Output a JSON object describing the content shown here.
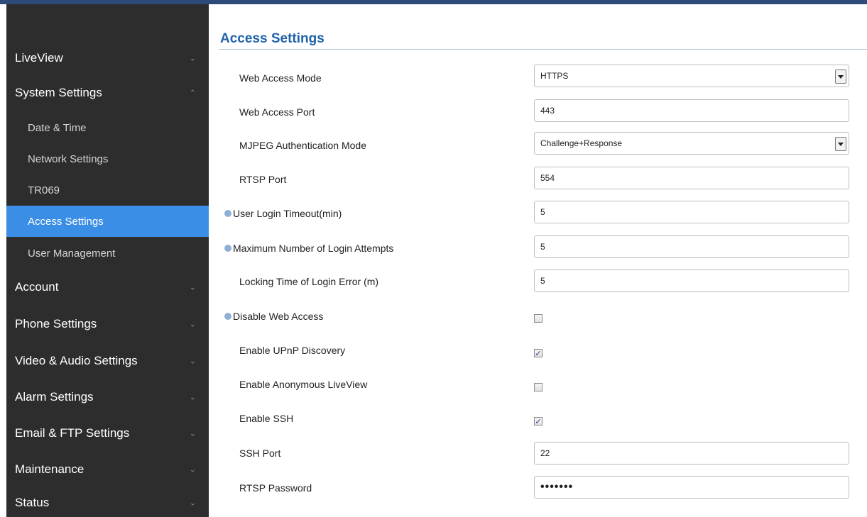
{
  "sidebar": {
    "items": [
      {
        "label": "LiveView",
        "chevron": "⌄"
      },
      {
        "label": "System Settings",
        "chevron": "⌃"
      },
      {
        "label": "Date & Time"
      },
      {
        "label": "Network Settings"
      },
      {
        "label": "TR069"
      },
      {
        "label": "Access Settings"
      },
      {
        "label": "User Management"
      },
      {
        "label": "Account",
        "chevron": "⌄"
      },
      {
        "label": "Phone Settings",
        "chevron": "⌄"
      },
      {
        "label": "Video & Audio Settings",
        "chevron": "⌄"
      },
      {
        "label": "Alarm Settings",
        "chevron": "⌄"
      },
      {
        "label": "Email & FTP Settings",
        "chevron": "⌄"
      },
      {
        "label": "Maintenance",
        "chevron": "⌄"
      },
      {
        "label": "Status",
        "chevron": "⌄"
      }
    ]
  },
  "main": {
    "title": "Access Settings",
    "rows": [
      {
        "label": "Web Access Mode",
        "value": "HTTPS",
        "type": "select"
      },
      {
        "label": "Web Access Port",
        "value": "443",
        "type": "text"
      },
      {
        "label": "MJPEG Authentication Mode",
        "value": "Challenge+Response",
        "type": "select"
      },
      {
        "label": "RTSP Port",
        "value": "554",
        "type": "text"
      },
      {
        "label": "User Login Timeout(min)",
        "value": "5",
        "type": "text",
        "info": true
      },
      {
        "label": "Maximum Number of Login Attempts",
        "value": "5",
        "type": "text",
        "info": true
      },
      {
        "label": "Locking Time of Login Error (m)",
        "value": "5",
        "type": "text"
      },
      {
        "label": "Disable Web Access",
        "checked": false,
        "type": "checkbox",
        "info": true
      },
      {
        "label": "Enable UPnP Discovery",
        "checked": true,
        "type": "checkbox"
      },
      {
        "label": "Enable Anonymous LiveView",
        "checked": false,
        "type": "checkbox"
      },
      {
        "label": "Enable SSH",
        "checked": true,
        "type": "checkbox"
      },
      {
        "label": "SSH Port",
        "value": "22",
        "type": "text"
      },
      {
        "label": "RTSP Password",
        "value": "•••••••",
        "type": "password"
      }
    ],
    "check_mark": "✓"
  },
  "colors": {
    "sidebar_bg": "#2d2d2d",
    "active_bg": "#3a8ee6",
    "title": "#1f63a8"
  }
}
